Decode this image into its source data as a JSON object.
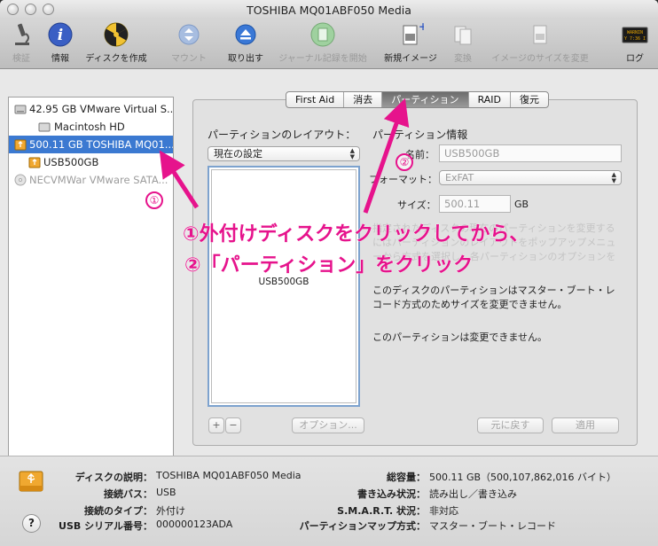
{
  "window": {
    "title": "TOSHIBA MQ01ABF050 Media"
  },
  "toolbar": {
    "items": [
      {
        "label": "検証",
        "icon": "microscope-icon",
        "enabled": false
      },
      {
        "label": "情報",
        "icon": "info-icon",
        "enabled": true
      },
      {
        "label": "ディスクを作成",
        "icon": "burn-icon",
        "enabled": true
      },
      {
        "label": "マウント",
        "icon": "mount-icon",
        "enabled": false
      },
      {
        "label": "取り出す",
        "icon": "eject-icon",
        "enabled": true
      },
      {
        "label": "ジャーナル記録を開始",
        "icon": "journal-icon",
        "enabled": false
      },
      {
        "label": "新規イメージ",
        "icon": "new-image-icon",
        "enabled": true
      },
      {
        "label": "変換",
        "icon": "convert-icon",
        "enabled": false
      },
      {
        "label": "イメージのサイズを変更",
        "icon": "resize-image-icon",
        "enabled": false
      },
      {
        "label": "ログ",
        "icon": "log-icon",
        "enabled": true,
        "badge": "WARNIN\nY 7:36 I"
      }
    ]
  },
  "sidebar": {
    "items": [
      {
        "label": "42.95 GB VMware Virtual S...",
        "icon": "hard-disk-icon",
        "level": 0,
        "selected": false,
        "enabled": true
      },
      {
        "label": "Macintosh HD",
        "icon": "volume-icon",
        "level": 1,
        "selected": false,
        "enabled": true
      },
      {
        "label": "500.11 GB TOSHIBA MQ01...",
        "icon": "usb-disk-icon",
        "level": 0,
        "selected": true,
        "enabled": true
      },
      {
        "label": "USB500GB",
        "icon": "usb-volume-icon",
        "level": 1,
        "selected": false,
        "enabled": true
      },
      {
        "label": "NECVMWar VMware SATA...",
        "icon": "optical-disc-icon",
        "level": 0,
        "selected": false,
        "enabled": false
      }
    ]
  },
  "tabs": [
    {
      "label": "First Aid",
      "active": false
    },
    {
      "label": "消去",
      "active": false
    },
    {
      "label": "パーティション",
      "active": true
    },
    {
      "label": "RAID",
      "active": false
    },
    {
      "label": "復元",
      "active": false
    }
  ],
  "partition": {
    "layout_heading": "パーティションのレイアウト：",
    "info_heading": "パーティション情報",
    "layout_select": "現在の設定",
    "name_label": "名前：",
    "name_value": "USB500GB",
    "format_label": "フォーマット：",
    "format_value": "ExFAT",
    "size_label": "サイズ：",
    "size_value": "500.11",
    "size_unit": "GB",
    "partition_name": "USB500GB",
    "description_hidden": "指定されたディスクの現在のパーティションを変更するにはパーティションのレイアウトをポップアップメニューから方式を選択し、各パーティションのオプションを設定して「適用」をクリックします。",
    "note1": "このディスクのパーティションはマスター・ブート・レコード方式のためサイズを変更できません。",
    "note2": "このパーティションは変更できません。",
    "add_btn": "+",
    "remove_btn": "−",
    "options_btn": "オプション...",
    "revert_btn": "元に戻す",
    "apply_btn": "適用"
  },
  "callouts": {
    "line1": "①外付けディスクをクリックしてから、",
    "line2": "②「パーティション」をクリック",
    "marker1": "①",
    "marker2": "②"
  },
  "details": {
    "description_label": "ディスクの説明：",
    "description_value": "TOSHIBA MQ01ABF050 Media",
    "bus_label": "接続バス：",
    "bus_value": "USB",
    "type_label": "接続のタイプ：",
    "type_value": "外付け",
    "serial_label": "USB シリアル番号：",
    "serial_value": "000000123ADA",
    "capacity_label": "総容量：",
    "capacity_value": "500.11 GB（500,107,862,016 バイト）",
    "write_label": "書き込み状況：",
    "write_value": "読み出し／書き込み",
    "smart_label": "S.M.A.R.T. 状況：",
    "smart_value": "非対応",
    "map_label": "パーティションマップ方式：",
    "map_value": "マスター・ブート・レコード"
  },
  "colors": {
    "accent": "#e6138c",
    "selection": "#3b79d1"
  }
}
